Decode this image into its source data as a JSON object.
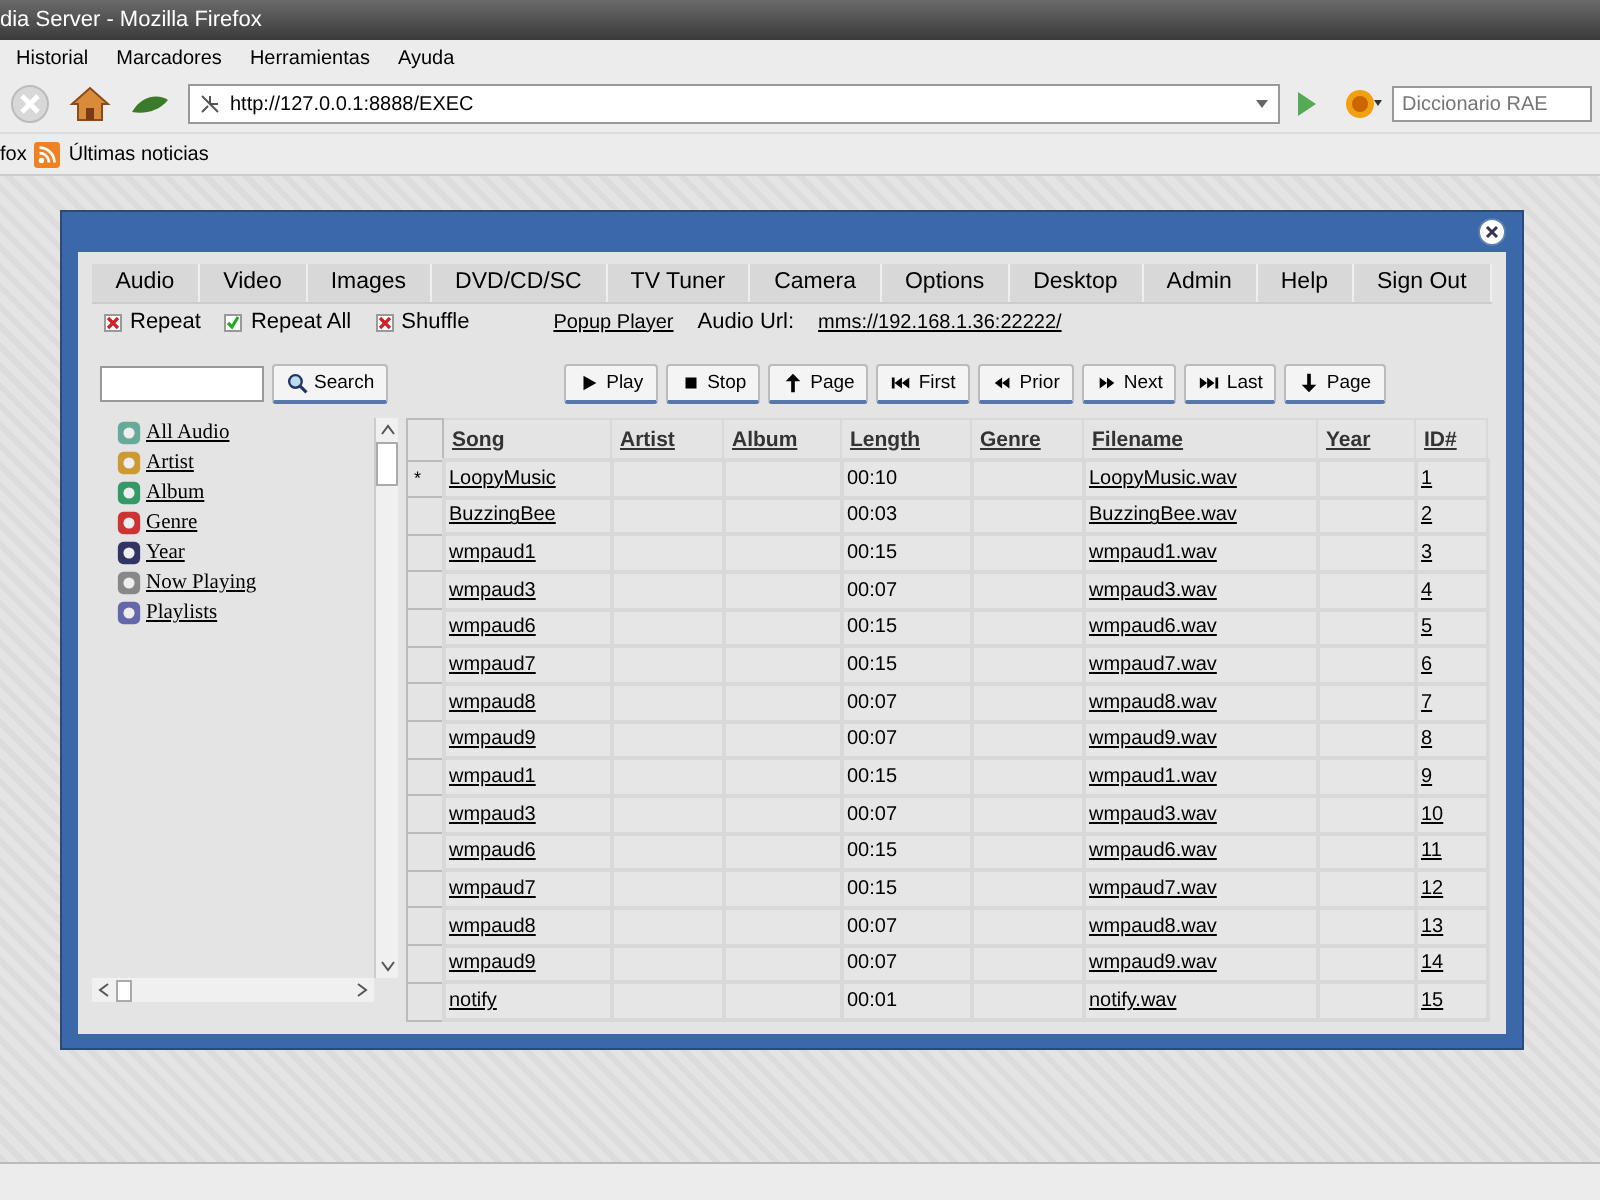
{
  "window": {
    "title": "dia Server - Mozilla Firefox"
  },
  "menu": [
    "Historial",
    "Marcadores",
    "Herramientas",
    "Ayuda"
  ],
  "address": {
    "value": "http://127.0.0.1:8888/EXEC"
  },
  "search_engine": {
    "placeholder": "Diccionario RAE"
  },
  "bookmarks": [
    {
      "label": "fox",
      "kind": "plain"
    },
    {
      "label": "Últimas noticias",
      "kind": "feed"
    }
  ],
  "tabs": [
    "Audio",
    "Video",
    "Images",
    "DVD/CD/SC",
    "TV Tuner",
    "Camera",
    "Options",
    "Desktop",
    "Admin",
    "Help",
    "Sign Out"
  ],
  "options": [
    {
      "label": "Repeat",
      "checked": false
    },
    {
      "label": "Repeat All",
      "checked": true
    },
    {
      "label": "Shuffle",
      "checked": false
    }
  ],
  "popup_link": "Popup Player",
  "audio_url": {
    "label": "Audio Url:",
    "value": "mms://192.168.1.36:22222/"
  },
  "search": {
    "button": "Search"
  },
  "toolbar": [
    {
      "label": "Play",
      "kind": "play"
    },
    {
      "label": "Stop",
      "kind": "stop"
    },
    {
      "label": "Page",
      "kind": "page_up"
    },
    {
      "label": "First",
      "kind": "first"
    },
    {
      "label": "Prior",
      "kind": "prior"
    },
    {
      "label": "Next",
      "kind": "next"
    },
    {
      "label": "Last",
      "kind": "last"
    },
    {
      "label": "Page",
      "kind": "page_down"
    }
  ],
  "tree": [
    "All Audio",
    "Artist",
    "Album",
    "Genre",
    "Year",
    "Now Playing",
    "Playlists"
  ],
  "table": {
    "columns": [
      "Song",
      "Artist",
      "Album",
      "Length",
      "Genre",
      "Filename",
      "Year",
      "ID#"
    ],
    "rows": [
      {
        "marker": "*",
        "song": "LoopyMusic",
        "length": "00:10",
        "filename": "LoopyMusic.wav",
        "id": "1"
      },
      {
        "song": "BuzzingBee",
        "length": "00:03",
        "filename": "BuzzingBee.wav",
        "id": "2"
      },
      {
        "song": "wmpaud1",
        "length": "00:15",
        "filename": "wmpaud1.wav",
        "id": "3"
      },
      {
        "song": "wmpaud3",
        "length": "00:07",
        "filename": "wmpaud3.wav",
        "id": "4"
      },
      {
        "song": "wmpaud6",
        "length": "00:15",
        "filename": "wmpaud6.wav",
        "id": "5"
      },
      {
        "song": "wmpaud7",
        "length": "00:15",
        "filename": "wmpaud7.wav",
        "id": "6"
      },
      {
        "song": "wmpaud8",
        "length": "00:07",
        "filename": "wmpaud8.wav",
        "id": "7"
      },
      {
        "song": "wmpaud9",
        "length": "00:07",
        "filename": "wmpaud9.wav",
        "id": "8"
      },
      {
        "song": "wmpaud1",
        "length": "00:15",
        "filename": "wmpaud1.wav",
        "id": "9"
      },
      {
        "song": "wmpaud3",
        "length": "00:07",
        "filename": "wmpaud3.wav",
        "id": "10"
      },
      {
        "song": "wmpaud6",
        "length": "00:15",
        "filename": "wmpaud6.wav",
        "id": "11"
      },
      {
        "song": "wmpaud7",
        "length": "00:15",
        "filename": "wmpaud7.wav",
        "id": "12"
      },
      {
        "song": "wmpaud8",
        "length": "00:07",
        "filename": "wmpaud8.wav",
        "id": "13"
      },
      {
        "song": "wmpaud9",
        "length": "00:07",
        "filename": "wmpaud9.wav",
        "id": "14"
      },
      {
        "song": "notify",
        "length": "00:01",
        "filename": "notify.wav",
        "id": "15"
      }
    ]
  }
}
